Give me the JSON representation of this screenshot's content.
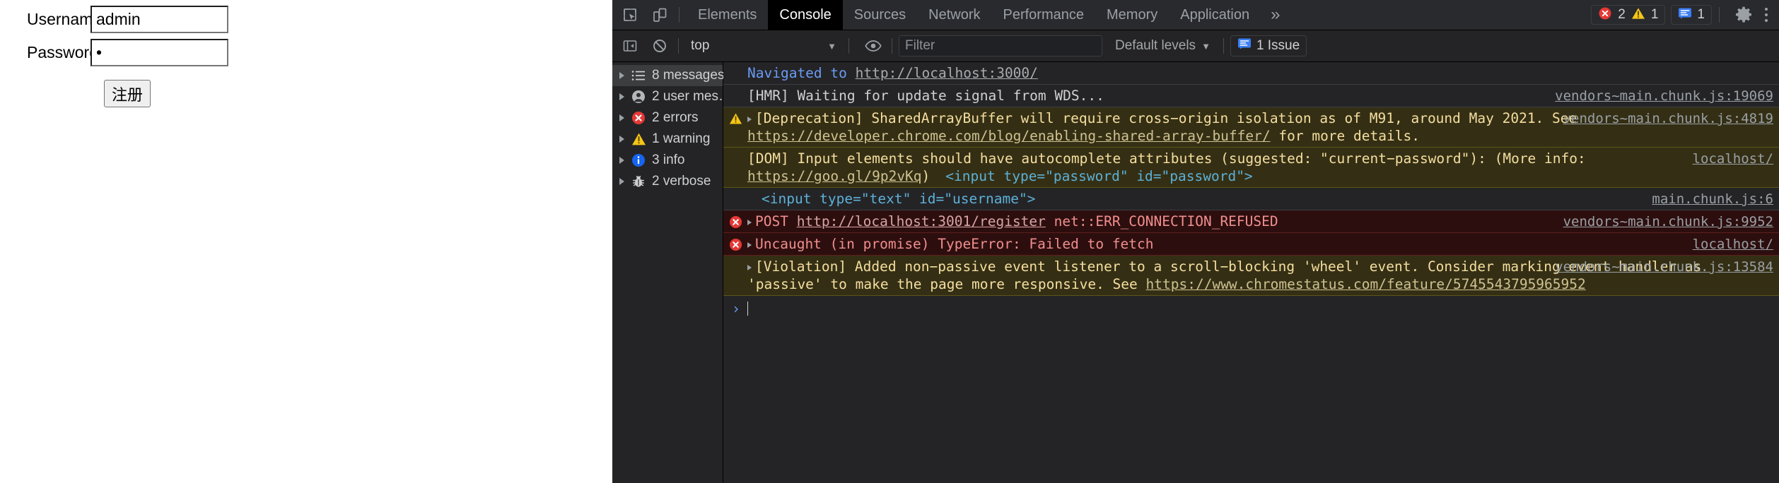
{
  "page": {
    "username": {
      "label": "Username",
      "value": "admin",
      "placeholder": ""
    },
    "password": {
      "label": "Password",
      "value": "•",
      "placeholder": ""
    },
    "submit_label": "注册"
  },
  "devtools": {
    "tabs": [
      {
        "label": "Elements",
        "active": false
      },
      {
        "label": "Console",
        "active": true
      },
      {
        "label": "Sources",
        "active": false
      },
      {
        "label": "Network",
        "active": false
      },
      {
        "label": "Performance",
        "active": false
      },
      {
        "label": "Memory",
        "active": false
      },
      {
        "label": "Application",
        "active": false
      }
    ],
    "more_tabs_label": "»",
    "icons": {
      "inspect": "inspect-element-icon",
      "device": "device-toolbar-icon",
      "gear": "settings-gear-icon",
      "kebab": "more-options-icon"
    },
    "status_counts": {
      "errors": "2",
      "warnings": "1",
      "issues": "1"
    },
    "console_toolbar": {
      "sidebar_toggle": "console-sidebar-toggle-icon",
      "clear": "clear-console-icon",
      "context": "top",
      "context_caret": "▼",
      "eye": "live-expression-icon",
      "filter_placeholder": "Filter",
      "filter_value": "",
      "levels_label": "Default levels",
      "levels_caret": "▼",
      "issues_label": "1 Issue"
    },
    "sidebar": [
      {
        "label": "8 messages",
        "icon": "list-icon",
        "selected": true
      },
      {
        "label": "2 user mes…",
        "icon": "user-icon",
        "selected": false
      },
      {
        "label": "2 errors",
        "icon": "error-icon",
        "selected": false
      },
      {
        "label": "1 warning",
        "icon": "warning-icon",
        "selected": false
      },
      {
        "label": "3 info",
        "icon": "info-icon",
        "selected": false
      },
      {
        "label": "2 verbose",
        "icon": "bug-icon",
        "selected": false
      }
    ],
    "messages": [
      {
        "kind": "nav",
        "prefix": "Navigated to ",
        "link": "http://localhost:3000/",
        "text": "",
        "source": "",
        "expandable": false,
        "gutter": ""
      },
      {
        "kind": "info",
        "prefix": "",
        "link": "",
        "text": "[HMR] Waiting for update signal from WDS...",
        "source": "vendors~main.chunk.js:19069",
        "expandable": false,
        "gutter": ""
      },
      {
        "kind": "warn",
        "prefix": "[Deprecation] SharedArrayBuffer will require cross−origin isolation as of M91, around May 2021. See ",
        "link": "https://developer.chrome.com/blog/enabling-shared-array-buffer/",
        "text": " for more details.",
        "source": "vendors~main.chunk.js:4819",
        "expandable": true,
        "gutter": "warning-icon"
      },
      {
        "kind": "warn",
        "prefix": "[DOM] Input elements should have autocomplete attributes (suggested: \"current−password\"): (More info: ",
        "link": "https://goo.gl/9p2vKq",
        "text": ")",
        "code": "<input type=\"password\" id=\"password\">",
        "source": "localhost/",
        "expandable": false,
        "gutter": ""
      },
      {
        "kind": "info",
        "prefix": "",
        "link": "",
        "code": "<input type=\"text\" id=\"username\">",
        "text": "",
        "source": "main.chunk.js:6",
        "expandable": false,
        "gutter": ""
      },
      {
        "kind": "err",
        "prefix": "POST ",
        "link": "http://localhost:3001/register",
        "text": " net::ERR_CONNECTION_REFUSED",
        "source": "vendors~main.chunk.js:9952",
        "expandable": true,
        "gutter": "error-icon"
      },
      {
        "kind": "err",
        "prefix": "Uncaught (in promise) TypeError: Failed to fetch",
        "link": "",
        "text": "",
        "source": "localhost/",
        "expandable": true,
        "gutter": "error-icon"
      },
      {
        "kind": "warn",
        "prefix": "[Violation] Added non−passive event listener to a scroll−blocking 'wheel' event. Consider marking event handler as 'passive' to make the page more responsive. See ",
        "link": "https://www.chromestatus.com/feature/5745543795965952",
        "text": "",
        "source": "vendors~main.chunk.js:13584",
        "expandable": true,
        "gutter": ""
      }
    ],
    "prompt": {
      "caret": "›",
      "value": ""
    }
  }
}
